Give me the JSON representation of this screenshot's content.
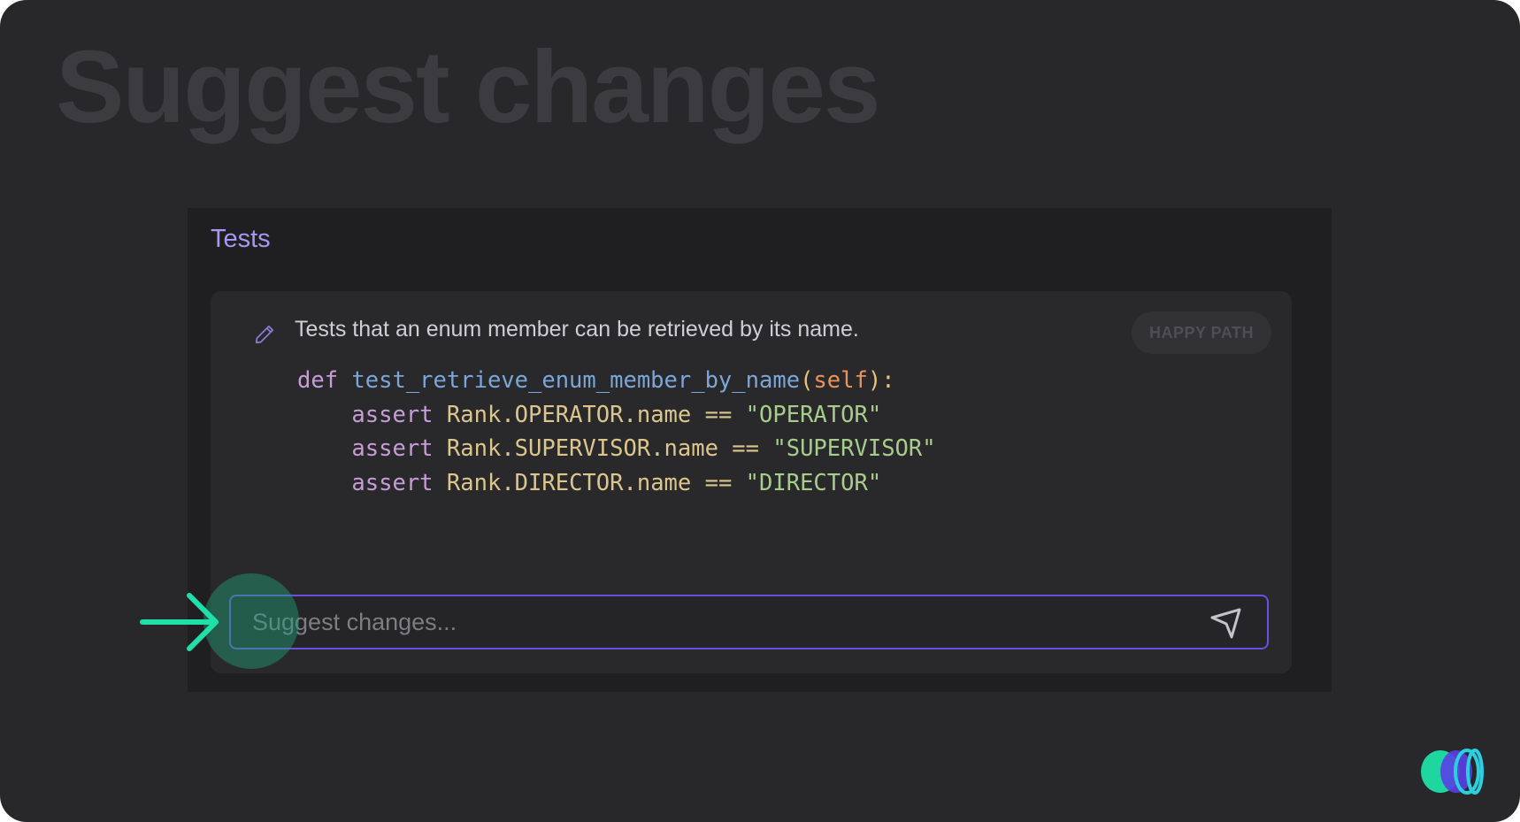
{
  "page": {
    "title": "Suggest changes"
  },
  "panel": {
    "title": "Tests"
  },
  "test_card": {
    "description": "Tests that an enum member can be retrieved by its name.",
    "badge": "HAPPY PATH",
    "code": {
      "def_keyword": "def",
      "function_name": "test_retrieve_enum_member_by_name",
      "paren_open": "(",
      "self_param": "self",
      "paren_close": "):",
      "lines": [
        {
          "keyword": "assert",
          "expression": "Rank.OPERATOR.name ==",
          "value": "\"OPERATOR\""
        },
        {
          "keyword": "assert",
          "expression": "Rank.SUPERVISOR.name ==",
          "value": "\"SUPERVISOR\""
        },
        {
          "keyword": "assert",
          "expression": "Rank.DIRECTOR.name ==",
          "value": "\"DIRECTOR\""
        }
      ]
    }
  },
  "suggest_input": {
    "placeholder": "Suggest changes...",
    "value": ""
  },
  "icons": {
    "edit": "pencil-icon",
    "send": "send-icon",
    "pointer": "arrow-right-icon",
    "brand": "logo-icon"
  },
  "colors": {
    "accent": "#6a4fe0",
    "panel_title": "#a996f0",
    "highlight": "#23a078",
    "arrow": "#1fe0a8"
  }
}
